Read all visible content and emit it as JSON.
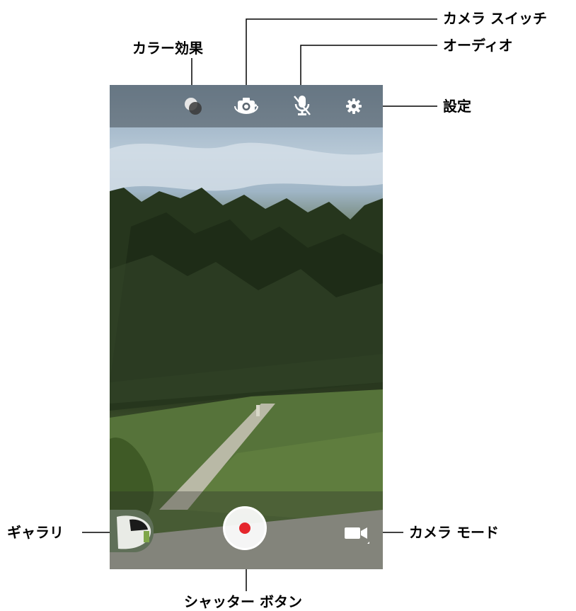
{
  "callouts": {
    "color_effect": "カラー効果",
    "camera_switch": "カメラ スイッチ",
    "audio": "オーディオ",
    "settings": "設定",
    "gallery": "ギャラリ",
    "camera_mode": "カメラ モード",
    "shutter_button": "シャッター ボタン"
  },
  "icons": {
    "color_effect": "color-effect-icon",
    "camera_switch": "camera-switch-icon",
    "audio": "microphone-off-icon",
    "settings": "gear-icon",
    "camera_mode": "video-camera-icon"
  },
  "colors": {
    "record_dot": "#e5262c",
    "top_bar": "#464e56"
  }
}
